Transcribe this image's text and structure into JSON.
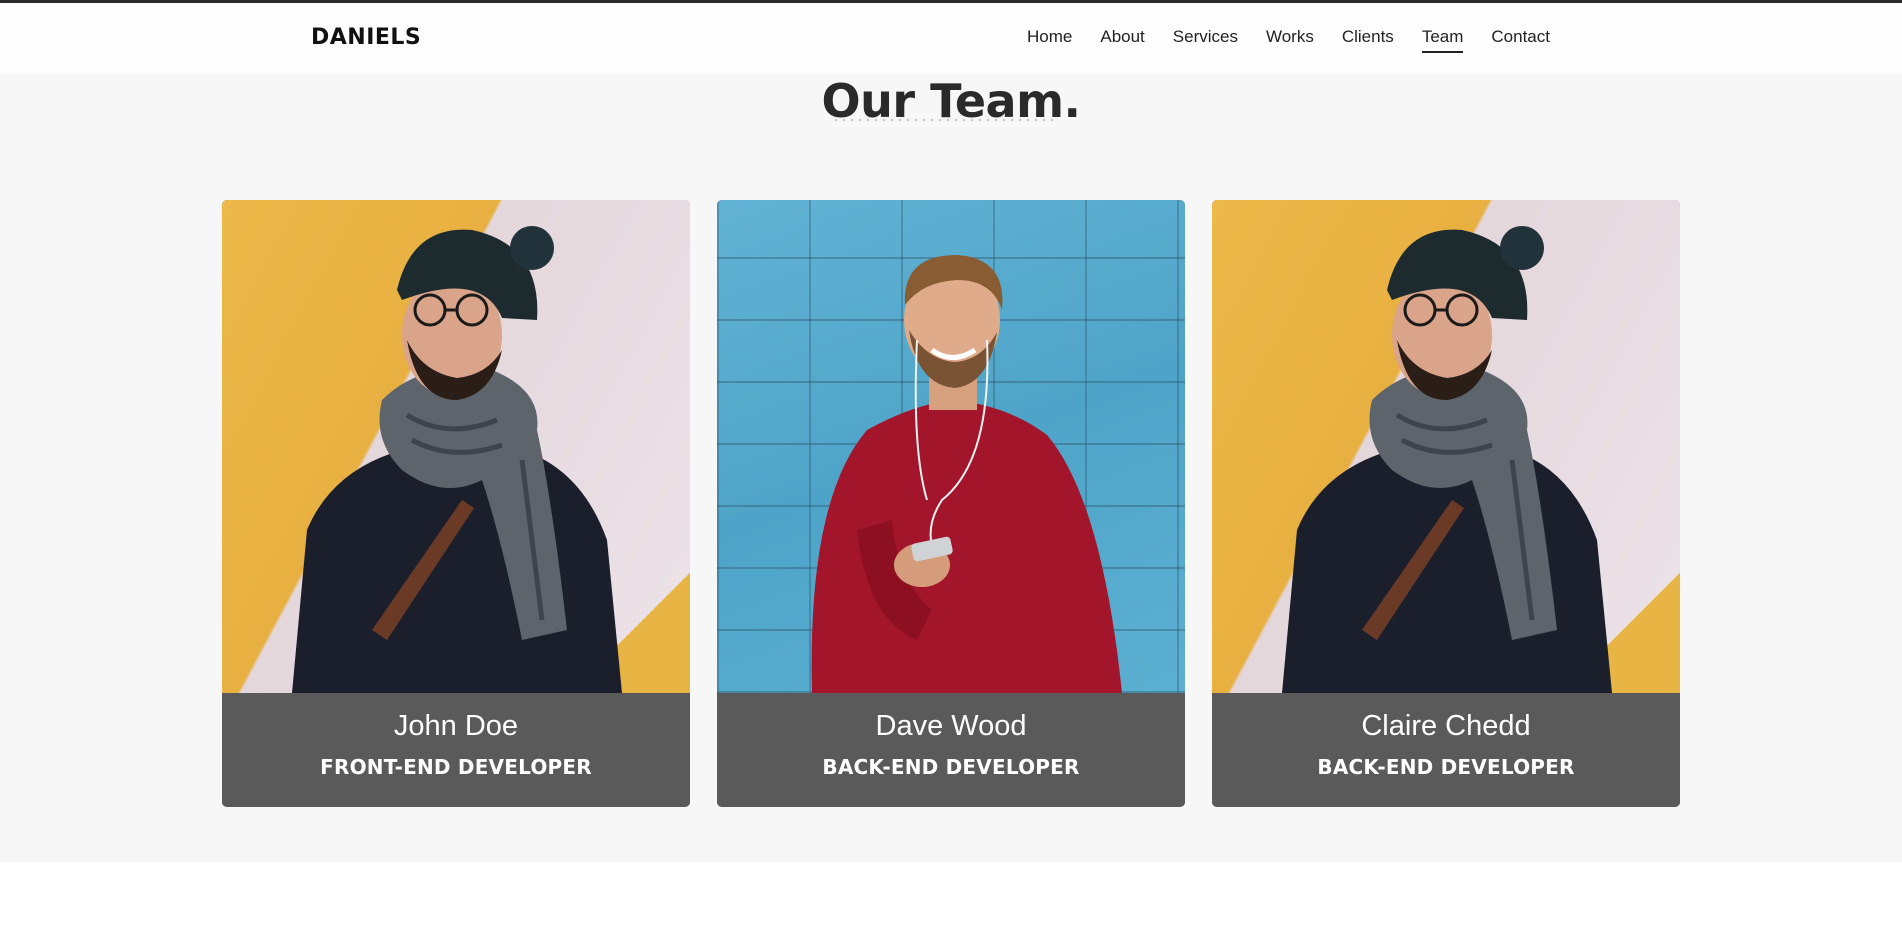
{
  "brand": {
    "name": "DANIELS"
  },
  "nav": {
    "items": [
      {
        "label": "Home"
      },
      {
        "label": "About"
      },
      {
        "label": "Services"
      },
      {
        "label": "Works"
      },
      {
        "label": "Clients"
      },
      {
        "label": "Team",
        "active": true
      },
      {
        "label": "Contact"
      }
    ]
  },
  "section": {
    "title": "Our Team."
  },
  "team": [
    {
      "name": "John Doe",
      "role": "FRONT-END DEVELOPER",
      "photo": "man-with-beanie-scarf-photo"
    },
    {
      "name": "Dave Wood",
      "role": "BACK-END DEVELOPER",
      "photo": "man-red-sweater-phone-photo"
    },
    {
      "name": "Claire Chedd",
      "role": "BACK-END DEVELOPER",
      "photo": "man-with-beanie-scarf-photo"
    }
  ],
  "colors": {
    "card_info_bg": "#5a5a5a",
    "section_bg": "#f7f7f7",
    "text_dark": "#2a2a2a"
  }
}
